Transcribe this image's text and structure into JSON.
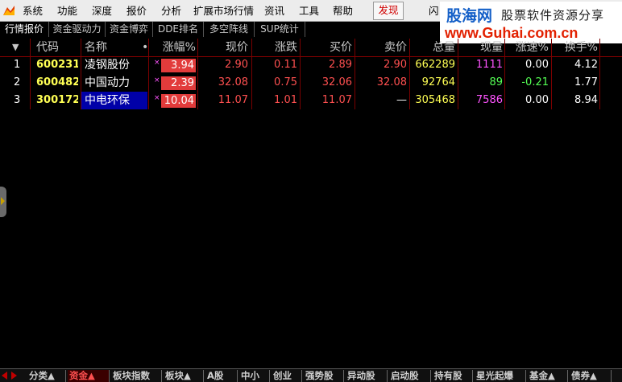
{
  "menu": {
    "items": [
      "系统",
      "功能",
      "深度",
      "报价",
      "分析",
      "扩展市场行情",
      "资讯",
      "工具",
      "帮助"
    ],
    "discover": "发现",
    "flash": "闪"
  },
  "watermark": {
    "brand": "股海网",
    "tagline": "股票软件资源分享",
    "url": "www.Guhai.com.cn"
  },
  "tabs": [
    "行情报价",
    "资金驱动力",
    "资金博弈",
    "DDE排名",
    "多空阵线",
    "SUP统计"
  ],
  "table": {
    "columns": [
      "▼",
      "代码",
      "名称",
      "•",
      "涨幅%",
      "现价",
      "涨跌",
      "买价",
      "卖价",
      "总量",
      "现量",
      "涨速%",
      "换手%"
    ],
    "rows": [
      {
        "idx": "1",
        "code": "600231",
        "name": "凌钢股份",
        "star": "×",
        "pct": "3.94",
        "price": "2.90",
        "change": "0.11",
        "bid": "2.89",
        "ask": "2.90",
        "volume": "662289",
        "cur_vol": "1111",
        "speed": "0.00",
        "turnover": "4.12"
      },
      {
        "idx": "2",
        "code": "600482",
        "name": "中国动力",
        "star": "×",
        "pct": "2.39",
        "price": "32.08",
        "change": "0.75",
        "bid": "32.06",
        "ask": "32.08",
        "volume": "92764",
        "cur_vol": "89",
        "speed": "-0.21",
        "turnover": "1.77"
      },
      {
        "idx": "3",
        "code": "300172",
        "name": "中电环保",
        "star": "×",
        "pct": "10.04",
        "price": "11.07",
        "change": "1.01",
        "bid": "11.07",
        "ask": "—",
        "volume": "305468",
        "cur_vol": "7586",
        "speed": "0.00",
        "turnover": "8.94"
      }
    ]
  },
  "bottom_tabs": [
    "分类▲",
    "资金▲",
    "板块指数",
    "板块▲",
    "A股",
    "中小",
    "创业",
    "强势股",
    "异动股",
    "启动股",
    "持有股",
    "星光起爆",
    "基金▲",
    "债券▲"
  ],
  "colors": {
    "up": "#ff5050",
    "down": "#54ff54",
    "code": "#ffff54",
    "highlight": "#0000a8",
    "pct_box": "#e23b3b"
  }
}
